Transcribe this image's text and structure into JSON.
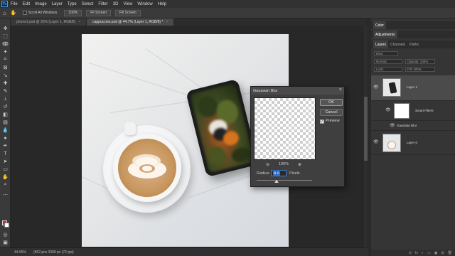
{
  "app": {
    "logo": "Ps"
  },
  "menu": [
    "File",
    "Edit",
    "Image",
    "Layer",
    "Type",
    "Select",
    "Filter",
    "3D",
    "View",
    "Window",
    "Help"
  ],
  "options_bar": {
    "scroll_all_label": "Scroll All Windows",
    "zoom_btn": "100%",
    "fit_btn": "Fit Screen",
    "fill_btn": "Fill Screen"
  },
  "tabs": [
    {
      "label": "phone1.psd @ 25% (Layer 1, RGB/8)",
      "close": "×"
    },
    {
      "label": "cappuccino.psd @ 44.7% (Layer 1, RGB/8) *",
      "close": "×"
    }
  ],
  "status": {
    "zoom": "44.65%",
    "doc": "(862 pcs 2000 px (72 ppi)"
  },
  "dialog": {
    "title": "Gaussian Blur",
    "close": "×",
    "ok": "OK",
    "cancel": "Cancel",
    "preview_label": "Preview",
    "zoom_out": "⊖",
    "zoom_level": "100%",
    "zoom_in": "⊕",
    "radius_label": "Radius:",
    "radius_value": "8.0",
    "radius_unit": "Pixels"
  },
  "panels": {
    "color_tab": "Color",
    "adjustments_tab": "Adjustments",
    "layer_tabs": [
      "Layers",
      "Channels",
      "Paths"
    ],
    "kind": "Kind",
    "blend": "Normal",
    "opacity": "Opacity: 100%",
    "lock": "Lock:",
    "fill": "Fill: 100%",
    "layers": [
      {
        "name": "Layer 1"
      },
      {
        "name": "Smart Filters"
      },
      {
        "name": "Gaussian Blur"
      },
      {
        "name": "Layer 0"
      }
    ],
    "footer_icons": [
      "⊘",
      "fx",
      "◐",
      "▭",
      "▣",
      "⊞",
      "🗑"
    ]
  }
}
